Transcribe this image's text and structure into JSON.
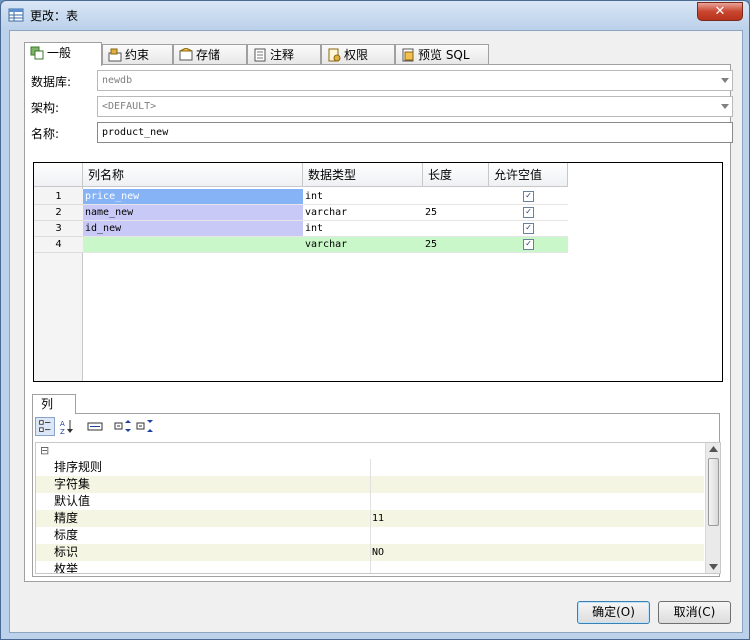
{
  "window": {
    "title": "更改：表",
    "close_label": "✕"
  },
  "tabs": [
    {
      "label": "一般",
      "icon": "general-icon",
      "active": true
    },
    {
      "label": "约束",
      "icon": "constraint-icon"
    },
    {
      "label": "存储",
      "icon": "storage-icon"
    },
    {
      "label": "注释",
      "icon": "comment-icon"
    },
    {
      "label": "权限",
      "icon": "permission-icon"
    },
    {
      "label": "预览 SQL",
      "icon": "preview-sql-icon"
    }
  ],
  "form": {
    "database_label": "数据库:",
    "database_value": "newdb",
    "schema_label": "架构:",
    "schema_value": "<DEFAULT>",
    "name_label": "名称:",
    "name_value": "product_new"
  },
  "columns_table": {
    "headers": [
      "列名称",
      "数据类型",
      "长度",
      "允许空值"
    ],
    "rows": [
      {
        "num": "1",
        "name": "price_new",
        "type": "int",
        "length": "",
        "nullable": true
      },
      {
        "num": "2",
        "name": "name_new",
        "type": "varchar",
        "length": "25",
        "nullable": true
      },
      {
        "num": "3",
        "name": "id_new",
        "type": "int",
        "length": "",
        "nullable": true
      },
      {
        "num": "4",
        "name": "",
        "type": "varchar",
        "length": "25",
        "nullable": true
      }
    ]
  },
  "lower_tab": {
    "label": "列"
  },
  "properties": {
    "collapse_symbol": "⊟",
    "rows": [
      {
        "name": "排序规则",
        "value": ""
      },
      {
        "name": "字符集",
        "value": ""
      },
      {
        "name": "默认值",
        "value": ""
      },
      {
        "name": "精度",
        "value": "11"
      },
      {
        "name": "标度",
        "value": ""
      },
      {
        "name": "标识",
        "value": "NO"
      },
      {
        "name": "枚举",
        "value": ""
      }
    ]
  },
  "buttons": {
    "ok": "确定(O)",
    "cancel": "取消(C)"
  },
  "colors": {
    "selected_row": "#c9c9f7",
    "selected_cell": "#86b3f5",
    "new_row": "#c9f7c9",
    "prop_alt": "#f5f5e4"
  }
}
